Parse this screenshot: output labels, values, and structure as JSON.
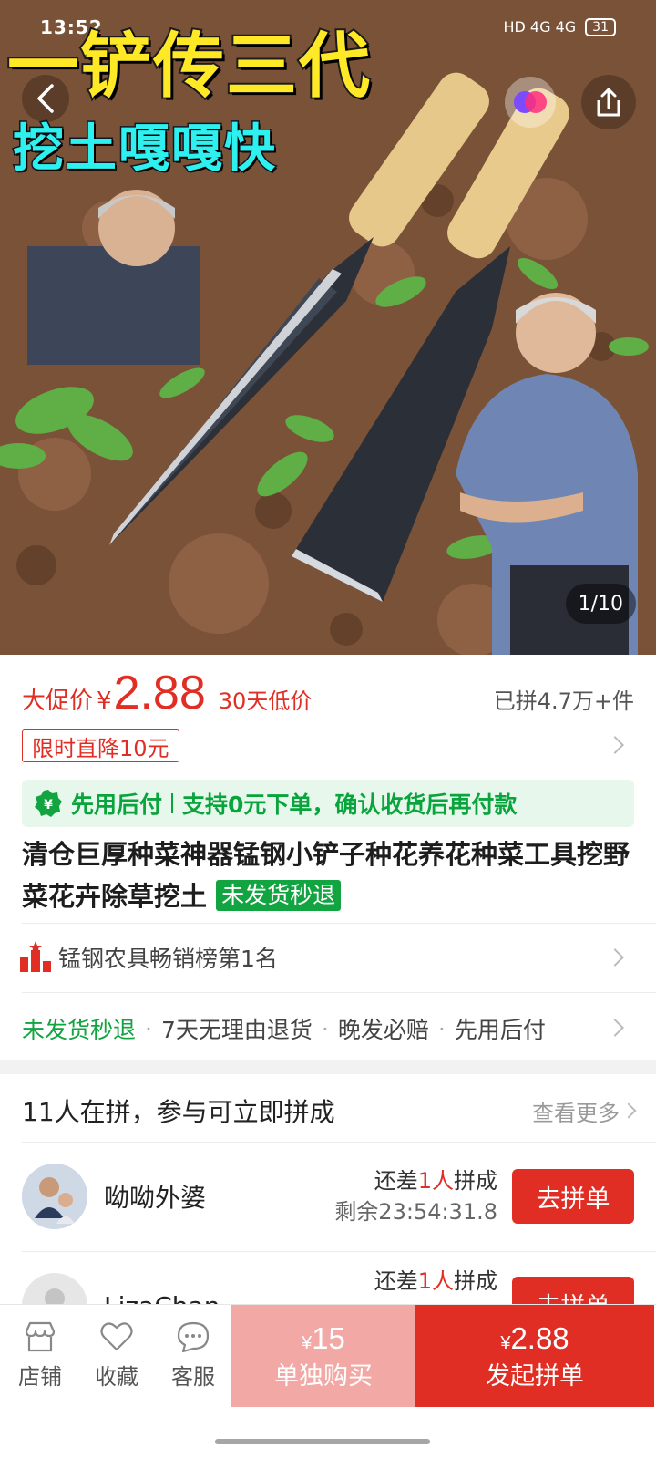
{
  "status_bar": {
    "time": "13:52",
    "network": "HD 4G 4G",
    "battery": "31"
  },
  "hero": {
    "banner_line_1": "一铲传三代",
    "banner_line_2": "挖土嘎嘎快",
    "pager": "1/10"
  },
  "price": {
    "promo_label": "大促价",
    "currency": "¥",
    "value": "2.88",
    "low_tag": "30天低价",
    "sold": "已拼4.7万+件",
    "limit_tag": "限时直降10元"
  },
  "pay_later": {
    "label": "先用后付",
    "text": "支持0元下单，确认收货后再付款"
  },
  "product": {
    "title": "清仓巨厚种菜神器锰钢小铲子种花养花种菜工具挖野菜花卉除草挖土",
    "badge": "未发货秒退"
  },
  "ranking": {
    "text": "锰钢农具畅销榜第1名"
  },
  "services": [
    "未发货秒退",
    "7天无理由退货",
    "晚发必赔",
    "先用后付"
  ],
  "group_buy": {
    "header": "11人在拼，参与可立即拼成",
    "more": "查看更多",
    "items": [
      {
        "name": "呦呦外婆",
        "need_prefix": "还差",
        "need_count": "1人",
        "need_suffix": "拼成",
        "remaining": "剩余23:54:31.8",
        "button": "去拼单"
      },
      {
        "name": "LizaChan",
        "need_prefix": "还差",
        "need_count": "1人",
        "need_suffix": "拼成",
        "remaining": "",
        "button": "去拼单"
      }
    ]
  },
  "bottom_bar": {
    "tabs": [
      {
        "label": "店铺",
        "icon": "store-icon"
      },
      {
        "label": "收藏",
        "icon": "heart-icon"
      },
      {
        "label": "客服",
        "icon": "chat-icon"
      }
    ],
    "solo": {
      "currency": "¥",
      "price": "15",
      "label": "单独购买"
    },
    "group": {
      "currency": "¥",
      "price": "2.88",
      "label": "发起拼单"
    }
  },
  "colors": {
    "accent_red": "#e02e24",
    "green": "#12a441",
    "solo_pink": "#f2a8a5"
  }
}
